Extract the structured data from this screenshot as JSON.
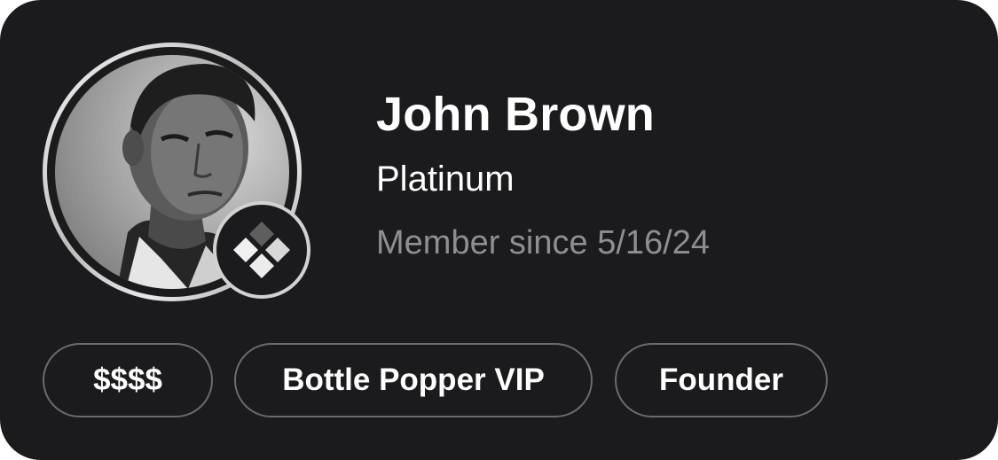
{
  "profile": {
    "name": "John Brown",
    "tier": "Platinum",
    "member_since": "Member since 5/16/24",
    "avatar_icon": "user-photo",
    "tier_badge_icon": "diamond-grid-icon"
  },
  "tags": [
    {
      "label": "$$$$"
    },
    {
      "label": "Bottle Popper VIP"
    },
    {
      "label": "Founder"
    }
  ],
  "colors": {
    "background": "#1b1b1d",
    "text_primary": "#ffffff",
    "text_secondary": "#8f8f93",
    "tag_border": "#6b6b6e"
  }
}
